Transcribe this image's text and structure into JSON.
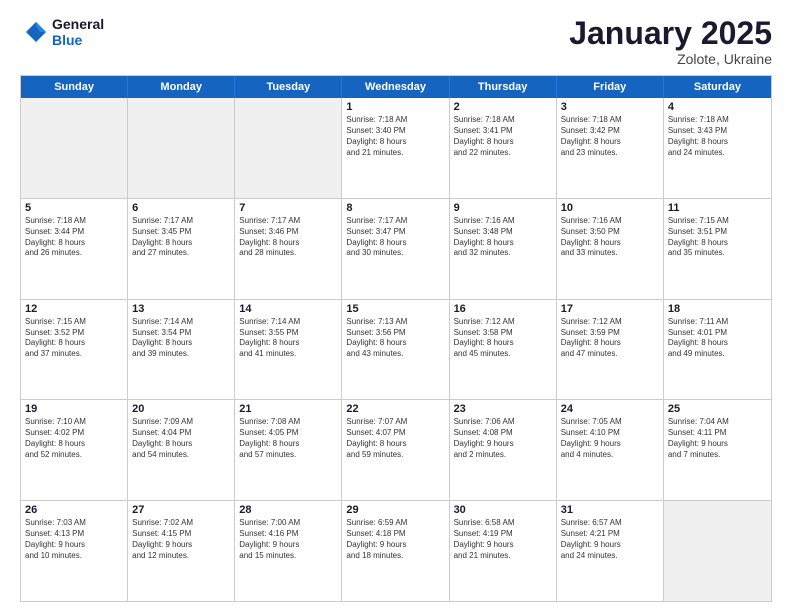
{
  "logo": {
    "line1": "General",
    "line2": "Blue"
  },
  "title": "January 2025",
  "subtitle": "Zolote, Ukraine",
  "days": [
    "Sunday",
    "Monday",
    "Tuesday",
    "Wednesday",
    "Thursday",
    "Friday",
    "Saturday"
  ],
  "weeks": [
    [
      {
        "day": "",
        "content": ""
      },
      {
        "day": "",
        "content": ""
      },
      {
        "day": "",
        "content": ""
      },
      {
        "day": "1",
        "content": "Sunrise: 7:18 AM\nSunset: 3:40 PM\nDaylight: 8 hours\nand 21 minutes."
      },
      {
        "day": "2",
        "content": "Sunrise: 7:18 AM\nSunset: 3:41 PM\nDaylight: 8 hours\nand 22 minutes."
      },
      {
        "day": "3",
        "content": "Sunrise: 7:18 AM\nSunset: 3:42 PM\nDaylight: 8 hours\nand 23 minutes."
      },
      {
        "day": "4",
        "content": "Sunrise: 7:18 AM\nSunset: 3:43 PM\nDaylight: 8 hours\nand 24 minutes."
      }
    ],
    [
      {
        "day": "5",
        "content": "Sunrise: 7:18 AM\nSunset: 3:44 PM\nDaylight: 8 hours\nand 26 minutes."
      },
      {
        "day": "6",
        "content": "Sunrise: 7:17 AM\nSunset: 3:45 PM\nDaylight: 8 hours\nand 27 minutes."
      },
      {
        "day": "7",
        "content": "Sunrise: 7:17 AM\nSunset: 3:46 PM\nDaylight: 8 hours\nand 28 minutes."
      },
      {
        "day": "8",
        "content": "Sunrise: 7:17 AM\nSunset: 3:47 PM\nDaylight: 8 hours\nand 30 minutes."
      },
      {
        "day": "9",
        "content": "Sunrise: 7:16 AM\nSunset: 3:48 PM\nDaylight: 8 hours\nand 32 minutes."
      },
      {
        "day": "10",
        "content": "Sunrise: 7:16 AM\nSunset: 3:50 PM\nDaylight: 8 hours\nand 33 minutes."
      },
      {
        "day": "11",
        "content": "Sunrise: 7:15 AM\nSunset: 3:51 PM\nDaylight: 8 hours\nand 35 minutes."
      }
    ],
    [
      {
        "day": "12",
        "content": "Sunrise: 7:15 AM\nSunset: 3:52 PM\nDaylight: 8 hours\nand 37 minutes."
      },
      {
        "day": "13",
        "content": "Sunrise: 7:14 AM\nSunset: 3:54 PM\nDaylight: 8 hours\nand 39 minutes."
      },
      {
        "day": "14",
        "content": "Sunrise: 7:14 AM\nSunset: 3:55 PM\nDaylight: 8 hours\nand 41 minutes."
      },
      {
        "day": "15",
        "content": "Sunrise: 7:13 AM\nSunset: 3:56 PM\nDaylight: 8 hours\nand 43 minutes."
      },
      {
        "day": "16",
        "content": "Sunrise: 7:12 AM\nSunset: 3:58 PM\nDaylight: 8 hours\nand 45 minutes."
      },
      {
        "day": "17",
        "content": "Sunrise: 7:12 AM\nSunset: 3:59 PM\nDaylight: 8 hours\nand 47 minutes."
      },
      {
        "day": "18",
        "content": "Sunrise: 7:11 AM\nSunset: 4:01 PM\nDaylight: 8 hours\nand 49 minutes."
      }
    ],
    [
      {
        "day": "19",
        "content": "Sunrise: 7:10 AM\nSunset: 4:02 PM\nDaylight: 8 hours\nand 52 minutes."
      },
      {
        "day": "20",
        "content": "Sunrise: 7:09 AM\nSunset: 4:04 PM\nDaylight: 8 hours\nand 54 minutes."
      },
      {
        "day": "21",
        "content": "Sunrise: 7:08 AM\nSunset: 4:05 PM\nDaylight: 8 hours\nand 57 minutes."
      },
      {
        "day": "22",
        "content": "Sunrise: 7:07 AM\nSunset: 4:07 PM\nDaylight: 8 hours\nand 59 minutes."
      },
      {
        "day": "23",
        "content": "Sunrise: 7:06 AM\nSunset: 4:08 PM\nDaylight: 9 hours\nand 2 minutes."
      },
      {
        "day": "24",
        "content": "Sunrise: 7:05 AM\nSunset: 4:10 PM\nDaylight: 9 hours\nand 4 minutes."
      },
      {
        "day": "25",
        "content": "Sunrise: 7:04 AM\nSunset: 4:11 PM\nDaylight: 9 hours\nand 7 minutes."
      }
    ],
    [
      {
        "day": "26",
        "content": "Sunrise: 7:03 AM\nSunset: 4:13 PM\nDaylight: 9 hours\nand 10 minutes."
      },
      {
        "day": "27",
        "content": "Sunrise: 7:02 AM\nSunset: 4:15 PM\nDaylight: 9 hours\nand 12 minutes."
      },
      {
        "day": "28",
        "content": "Sunrise: 7:00 AM\nSunset: 4:16 PM\nDaylight: 9 hours\nand 15 minutes."
      },
      {
        "day": "29",
        "content": "Sunrise: 6:59 AM\nSunset: 4:18 PM\nDaylight: 9 hours\nand 18 minutes."
      },
      {
        "day": "30",
        "content": "Sunrise: 6:58 AM\nSunset: 4:19 PM\nDaylight: 9 hours\nand 21 minutes."
      },
      {
        "day": "31",
        "content": "Sunrise: 6:57 AM\nSunset: 4:21 PM\nDaylight: 9 hours\nand 24 minutes."
      },
      {
        "day": "",
        "content": ""
      }
    ]
  ]
}
